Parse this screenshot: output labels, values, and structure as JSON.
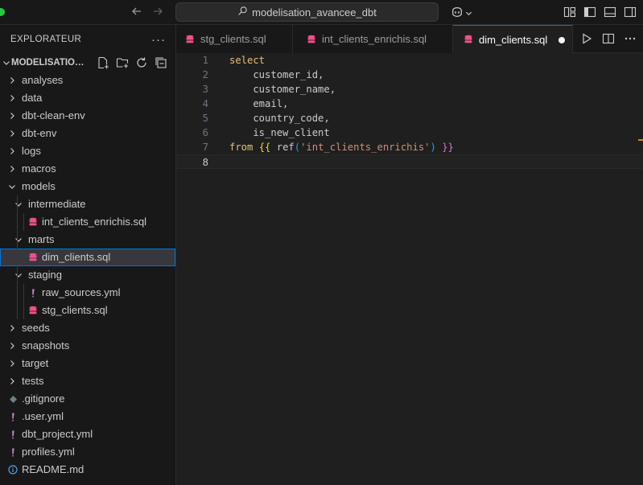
{
  "titlebar": {
    "search_text": "modelisation_avancee_dbt",
    "icons": [
      "back-arrow-icon",
      "forward-arrow-icon",
      "search-icon",
      "copilot-icon",
      "toggle-primary-sidebar-icon",
      "toggle-panel-icon",
      "toggle-secondary-sidebar-icon",
      "customize-layout-icon"
    ]
  },
  "sidebar": {
    "title": "EXPLORATEUR",
    "more": "···",
    "project": "MODELISATION_AVANCEE_DBT",
    "items": [
      {
        "label": "analyses",
        "type": "folder",
        "depth": 0,
        "expanded": false
      },
      {
        "label": "data",
        "type": "folder",
        "depth": 0,
        "expanded": false
      },
      {
        "label": "dbt-clean-env",
        "type": "folder",
        "depth": 0,
        "expanded": false
      },
      {
        "label": "dbt-env",
        "type": "folder",
        "depth": 0,
        "expanded": false
      },
      {
        "label": "logs",
        "type": "folder",
        "depth": 0,
        "expanded": false
      },
      {
        "label": "macros",
        "type": "folder",
        "depth": 0,
        "expanded": false
      },
      {
        "label": "models",
        "type": "folder",
        "depth": 0,
        "expanded": true
      },
      {
        "label": "intermediate",
        "type": "folder",
        "depth": 1,
        "expanded": true
      },
      {
        "label": "int_clients_enrichis.sql",
        "type": "sql",
        "depth": 2
      },
      {
        "label": "marts",
        "type": "folder",
        "depth": 1,
        "expanded": true
      },
      {
        "label": "dim_clients.sql",
        "type": "sql",
        "depth": 2,
        "selected": true
      },
      {
        "label": "staging",
        "type": "folder",
        "depth": 1,
        "expanded": true
      },
      {
        "label": "raw_sources.yml",
        "type": "yml",
        "depth": 2
      },
      {
        "label": "stg_clients.sql",
        "type": "sql",
        "depth": 2
      },
      {
        "label": "seeds",
        "type": "folder",
        "depth": 0,
        "expanded": false
      },
      {
        "label": "snapshots",
        "type": "folder",
        "depth": 0,
        "expanded": false
      },
      {
        "label": "target",
        "type": "folder",
        "depth": 0,
        "expanded": false
      },
      {
        "label": "tests",
        "type": "folder",
        "depth": 0,
        "expanded": false
      },
      {
        "label": ".gitignore",
        "type": "git",
        "depth": 0
      },
      {
        "label": ".user.yml",
        "type": "yml",
        "depth": 0
      },
      {
        "label": "dbt_project.yml",
        "type": "yml",
        "depth": 0
      },
      {
        "label": "profiles.yml",
        "type": "yml",
        "depth": 0
      },
      {
        "label": "README.md",
        "type": "info",
        "depth": 0
      }
    ]
  },
  "tabs": [
    {
      "label": "stg_clients.sql",
      "active": false
    },
    {
      "label": "int_clients_enrichis.sql",
      "active": false
    },
    {
      "label": "dim_clients.sql",
      "active": true,
      "dirty": true
    }
  ],
  "editor": {
    "lines": [
      {
        "n": "1",
        "tokens": [
          {
            "t": "select",
            "c": "kw"
          }
        ]
      },
      {
        "n": "2",
        "tokens": [
          {
            "t": "    customer_id,",
            "c": ""
          }
        ]
      },
      {
        "n": "3",
        "tokens": [
          {
            "t": "    customer_name,",
            "c": ""
          }
        ]
      },
      {
        "n": "4",
        "tokens": [
          {
            "t": "    email,",
            "c": ""
          }
        ]
      },
      {
        "n": "5",
        "tokens": [
          {
            "t": "    country_code,",
            "c": ""
          }
        ]
      },
      {
        "n": "6",
        "tokens": [
          {
            "t": "    is_new_client",
            "c": ""
          }
        ]
      },
      {
        "n": "7",
        "tokens": [
          {
            "t": "from",
            "c": "kw"
          },
          {
            "t": " ",
            "c": ""
          },
          {
            "t": "{{",
            "c": "brace1"
          },
          {
            "t": " ref",
            "c": ""
          },
          {
            "t": "(",
            "c": "paren"
          },
          {
            "t": "'int_clients_enrichis'",
            "c": "str"
          },
          {
            "t": ")",
            "c": "paren"
          },
          {
            "t": " ",
            "c": ""
          },
          {
            "t": "}}",
            "c": "brace2"
          }
        ]
      },
      {
        "n": "8",
        "tokens": []
      }
    ],
    "current_line": "8"
  },
  "colors": {
    "accent": "#0078d4",
    "sql_icon": "#f0508c",
    "yml_icon": "#c586c0",
    "info_icon": "#4aa3e8",
    "keyword": "#e5c07b",
    "string": "#ce9178"
  }
}
